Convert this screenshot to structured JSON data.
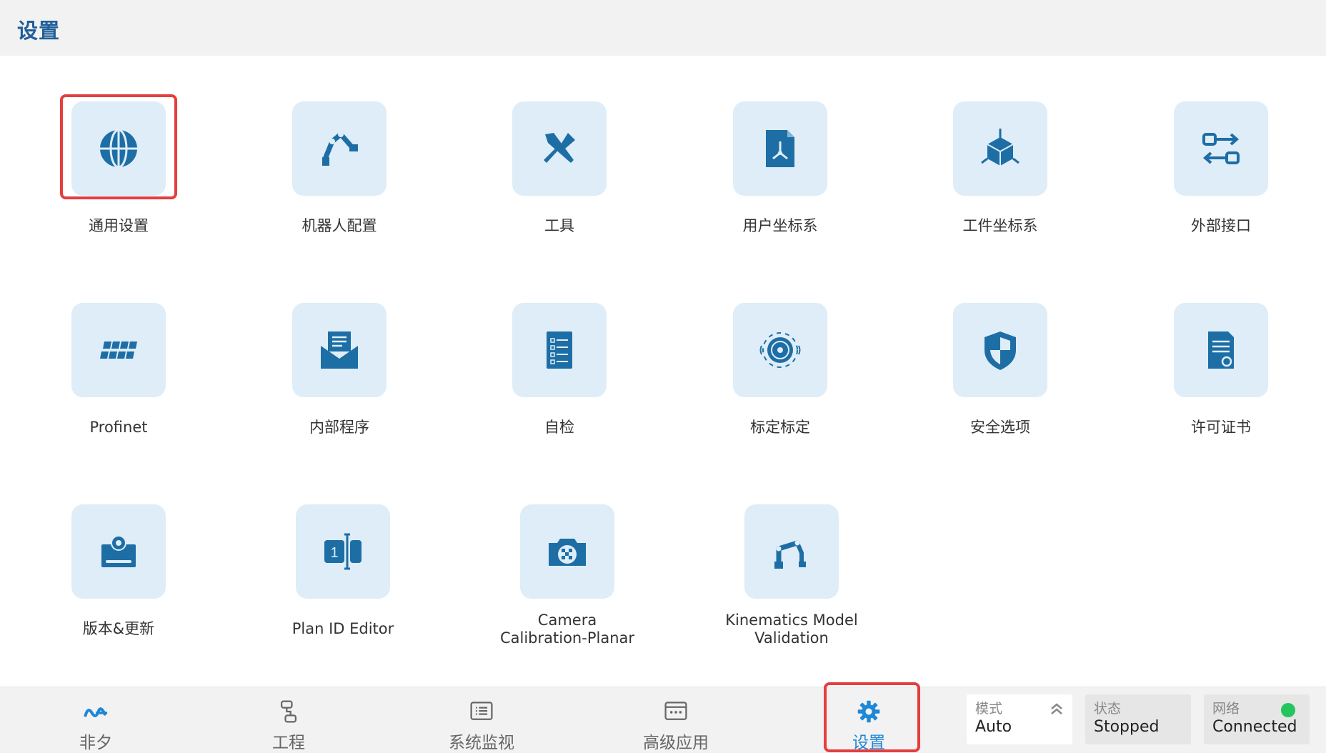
{
  "header": {
    "title": "设置"
  },
  "tiles": [
    {
      "label": "通用设置",
      "icon": "globe-icon"
    },
    {
      "label": "机器人配置",
      "icon": "robot-arm-icon"
    },
    {
      "label": "工具",
      "icon": "tools-icon"
    },
    {
      "label": "用户坐标系",
      "icon": "user-frame-icon"
    },
    {
      "label": "工件坐标系",
      "icon": "workpiece-frame-icon"
    },
    {
      "label": "外部接口",
      "icon": "external-interface-icon"
    },
    {
      "label": "Profinet",
      "icon": "profinet-icon"
    },
    {
      "label": "内部程序",
      "icon": "internal-program-icon"
    },
    {
      "label": "自检",
      "icon": "self-check-icon"
    },
    {
      "label": "标定标定",
      "icon": "calibration-icon"
    },
    {
      "label": "安全选项",
      "icon": "shield-icon"
    },
    {
      "label": "许可证书",
      "icon": "license-icon"
    },
    {
      "label": "版本&更新",
      "icon": "version-update-icon"
    },
    {
      "label": "Plan ID Editor",
      "icon": "plan-id-icon"
    },
    {
      "label": "Camera Calibration-Planar",
      "icon": "camera-icon"
    },
    {
      "label": "Kinematics Model Validation",
      "icon": "kinematics-icon"
    }
  ],
  "nav": [
    {
      "label": "非夕",
      "icon": "flexiv-logo-icon"
    },
    {
      "label": "工程",
      "icon": "project-icon"
    },
    {
      "label": "系统监视",
      "icon": "monitor-icon"
    },
    {
      "label": "高级应用",
      "icon": "advanced-app-icon"
    },
    {
      "label": "设置",
      "icon": "gear-icon"
    }
  ],
  "status": {
    "mode": {
      "key": "模式",
      "value": "Auto"
    },
    "state": {
      "key": "状态",
      "value": "Stopped"
    },
    "network": {
      "key": "网络",
      "value": "Connected"
    }
  },
  "colors": {
    "icon_blue": "#1e6ea6",
    "tile_bg": "#deedf7",
    "selected_border": "#e53e3e",
    "active_nav": "#1e88d6",
    "network_ok": "#22c55e"
  }
}
